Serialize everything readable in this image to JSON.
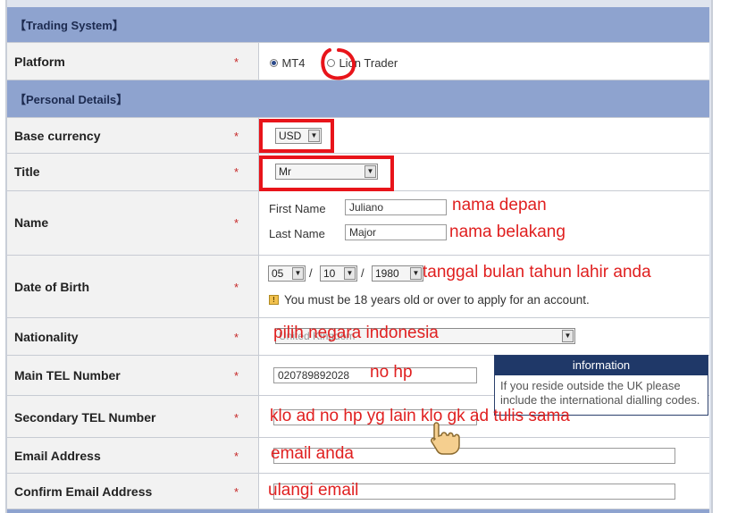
{
  "sections": {
    "trading_system": "【Trading System】",
    "personal_details": "【Personal Details】"
  },
  "required_mark": "*",
  "platform": {
    "label": "Platform",
    "options": [
      "MT4",
      "Lion Trader"
    ],
    "selected": "MT4"
  },
  "base_currency": {
    "label": "Base currency",
    "value": "USD"
  },
  "title_field": {
    "label": "Title",
    "value": "Mr"
  },
  "name": {
    "label": "Name",
    "first_label": "First Name",
    "first_value": "Juliano",
    "last_label": "Last Name",
    "last_value": "Major"
  },
  "dob": {
    "label": "Date of Birth",
    "day": "05",
    "month": "10",
    "year": "1980",
    "separator": "/",
    "note": "You must be 18 years old or over to apply for an account."
  },
  "nationality": {
    "label": "Nationality",
    "value": "United Kingdom"
  },
  "main_tel": {
    "label": "Main TEL Number",
    "value": "020789892028"
  },
  "secondary_tel": {
    "label": "Secondary TEL Number",
    "value": ""
  },
  "email": {
    "label": "Email Address",
    "value": ""
  },
  "confirm_email": {
    "label": "Confirm Email Address",
    "value": ""
  },
  "info_panel": {
    "title": "information",
    "body": "If you reside outside the UK please include the international dialling codes."
  },
  "annotations": {
    "first_name": "nama depan",
    "last_name": "nama belakang",
    "dob": "tanggal bulan tahun lahir anda",
    "nationality": "pilih negara indonesia",
    "main_tel": "no hp",
    "secondary_tel": "klo ad no hp yg lain klo gk ad tulis sama",
    "email": "email anda",
    "confirm_email": "ulangi email"
  },
  "colors": {
    "section_header": "#8ea3cf",
    "annotation": "#e02020",
    "info_header": "#1f3868"
  },
  "icons": {
    "select_arrow": "triangle-down",
    "note": "warning-square",
    "cursor": "hand-pointer"
  }
}
